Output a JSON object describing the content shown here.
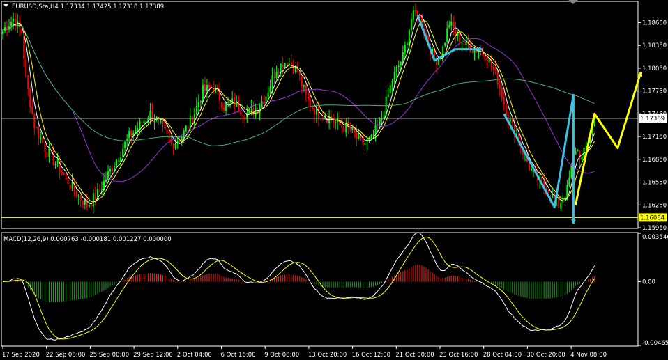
{
  "colors": {
    "bg": "#000000",
    "frame": "#ffffff",
    "bull": "#00ff00",
    "bear": "#ff0000",
    "ma_fast": "#ffffff",
    "ma_mid": "#ffff00",
    "ma_slow1": "#9b30d9",
    "ma_slow2": "#3cb371",
    "cyan": "#35c3e6",
    "yellow_path": "#ffff00",
    "hline": "#ffffff",
    "support": "#ffff66",
    "macd_hist_pos": "#ff2020",
    "macd_hist_neg": "#1aa11a",
    "macd_main": "#ffffff",
    "macd_signal": "#ffff00"
  },
  "main_header": "EURUSD,Sta,H4  1.17334 1.17425 1.17318 1.17389",
  "macd_header": "MACD(12,26,9) 0.000763 -0.000181 0.001227 0.000000",
  "chart_data": [
    {
      "type": "candlestick",
      "title": "EURUSD,Sta,H4  1.17334 1.17425 1.17318 1.17389",
      "ylim": [
        1.1595,
        1.1892
      ],
      "yticks": [
        "1.18650",
        "1.18350",
        "1.18050",
        "1.17750",
        "1.17450",
        "1.17150",
        "1.16850",
        "1.16550",
        "1.16250",
        "1.15950"
      ],
      "current_price_label": "1.17389",
      "current_price": 1.17389,
      "support_label": "1.16084",
      "support_price": 1.16084,
      "xticks": [
        "17 Sep 2020",
        "22 Sep 08:00",
        "25 Sep 00:00",
        "29 Sep 12:00",
        "2 Oct 04:00",
        "6 Oct 16:00",
        "9 Oct 08:00",
        "13 Oct 20:00",
        "16 Oct 12:00",
        "21 Oct 00:00",
        "23 Oct 16:00",
        "28 Oct 04:00",
        "30 Oct 20:00",
        "4 Nov 08:00"
      ],
      "close_keypoints": [
        [
          0,
          1.1855
        ],
        [
          5,
          1.187
        ],
        [
          9,
          1.1852
        ],
        [
          11,
          1.179
        ],
        [
          15,
          1.173
        ],
        [
          20,
          1.17
        ],
        [
          25,
          1.168
        ],
        [
          30,
          1.166
        ],
        [
          35,
          1.164
        ],
        [
          40,
          1.1625
        ],
        [
          45,
          1.164
        ],
        [
          50,
          1.1665
        ],
        [
          55,
          1.169
        ],
        [
          60,
          1.1715
        ],
        [
          65,
          1.173
        ],
        [
          70,
          1.1745
        ],
        [
          75,
          1.173
        ],
        [
          80,
          1.1705
        ],
        [
          85,
          1.1715
        ],
        [
          90,
          1.174
        ],
        [
          95,
          1.1775
        ],
        [
          100,
          1.178
        ],
        [
          105,
          1.1755
        ],
        [
          110,
          1.176
        ],
        [
          115,
          1.1745
        ],
        [
          120,
          1.175
        ],
        [
          125,
          1.177
        ],
        [
          130,
          1.1805
        ],
        [
          135,
          1.1815
        ],
        [
          140,
          1.18
        ],
        [
          145,
          1.176
        ],
        [
          150,
          1.1745
        ],
        [
          155,
          1.174
        ],
        [
          160,
          1.173
        ],
        [
          165,
          1.1725
        ],
        [
          170,
          1.1705
        ],
        [
          175,
          1.171
        ],
        [
          180,
          1.174
        ],
        [
          185,
          1.179
        ],
        [
          190,
          1.182
        ],
        [
          194,
          1.187
        ],
        [
          197,
          1.188
        ],
        [
          200,
          1.1855
        ],
        [
          205,
          1.1815
        ],
        [
          208,
          1.182
        ],
        [
          212,
          1.1865
        ],
        [
          215,
          1.185
        ],
        [
          220,
          1.1835
        ],
        [
          225,
          1.183
        ],
        [
          230,
          1.182
        ],
        [
          235,
          1.179
        ],
        [
          240,
          1.174
        ],
        [
          245,
          1.171
        ],
        [
          250,
          1.1675
        ],
        [
          255,
          1.1655
        ],
        [
          260,
          1.164
        ],
        [
          264,
          1.1625
        ],
        [
          268,
          1.1645
        ],
        [
          272,
          1.17
        ],
        [
          275,
          1.1685
        ],
        [
          278,
          1.171
        ],
        [
          281,
          1.1739
        ]
      ],
      "ma_periods": [
        5,
        8,
        34,
        89
      ],
      "annotations": {
        "cyan_path": [
          [
            197,
            1.1875
          ],
          [
            205,
            1.1815
          ],
          [
            215,
            1.183
          ],
          [
            228,
            1.183
          ]
        ],
        "cyan_path2": [
          [
            238,
            1.1745
          ],
          [
            262,
            1.1622
          ],
          [
            271,
            1.177
          ],
          [
            271,
            1.16
          ]
        ],
        "yellow_path": [
          [
            272,
            1.1625
          ],
          [
            281,
            1.1745
          ],
          [
            292,
            1.17
          ],
          [
            303,
            1.18
          ]
        ]
      }
    },
    {
      "type": "macd",
      "title": "MACD(12,26,9) 0.000763 -0.000181 0.001227 0.000000",
      "ylim": [
        -0.004653,
        0.003546
      ],
      "yticks": [
        "0.003546",
        "0.00",
        "-0.004653"
      ]
    }
  ]
}
